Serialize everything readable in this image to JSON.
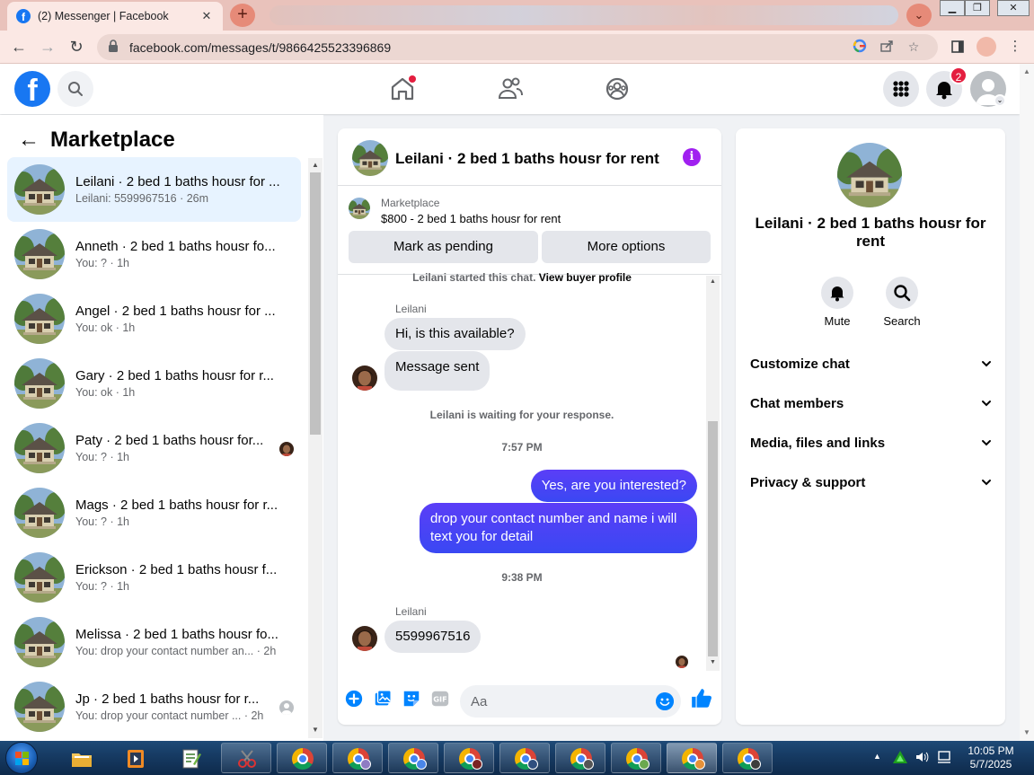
{
  "browser": {
    "tab_title": "(2) Messenger | Facebook",
    "url": "facebook.com/messages/t/9866425523396869",
    "accent": "#e9c2bb"
  },
  "fb": {
    "notification_count": "2",
    "brand_color": "#1877f2"
  },
  "sidebar": {
    "title": "Marketplace",
    "conversations": [
      {
        "name": "Leilani · 2 bed 1 baths housr for ...",
        "sub": "Leilani: 5599967516 · 26m",
        "active": true
      },
      {
        "name": "Anneth · 2 bed 1 baths housr fo...",
        "sub": "You: ? · 1h"
      },
      {
        "name": "Angel · 2 bed 1 baths housr for ...",
        "sub": "You: ok · 1h"
      },
      {
        "name": "Gary · 2 bed 1 baths housr for r...",
        "sub": "You: ok · 1h"
      },
      {
        "name": "Paty · 2 bed 1 baths housr for...",
        "sub": "You: ? · 1h",
        "seen_avatar": "photo"
      },
      {
        "name": "Mags · 2 bed 1 baths housr for r...",
        "sub": "You: ? · 1h"
      },
      {
        "name": "Erickson · 2 bed 1 baths housr f...",
        "sub": "You: ? · 1h"
      },
      {
        "name": "Melissa · 2 bed 1 baths housr fo...",
        "sub": "You: drop your contact number an... · 2h"
      },
      {
        "name": "Jp · 2 bed 1 baths housr for r...",
        "sub": "You: drop your contact number ... · 2h",
        "seen_avatar": "default"
      }
    ]
  },
  "chat": {
    "title": "Leilani · 2 bed 1 baths housr for rent",
    "item_label": "Marketplace",
    "item_price": "$800 - 2 bed 1 baths housr for rent",
    "mark_pending": "Mark as pending",
    "more_options": "More options",
    "started_text": "Leilani started this chat.",
    "view_profile": "View buyer profile",
    "sender_name": "Leilani",
    "msg1": "Hi, is this available?",
    "msg2": "Message sent",
    "waiting": "Leilani is waiting for your response.",
    "time1": "7:57 PM",
    "out1": "Yes, are you interested?",
    "out2": "drop your contact number and name i will text you for detail",
    "time2": "9:38 PM",
    "sender_name2": "Leilani",
    "msg3": "5599967516",
    "composer_placeholder": "Aa",
    "outgoing_color": "#4c3ff0"
  },
  "info": {
    "title": "Leilani · 2 bed 1 baths housr for rent",
    "mute": "Mute",
    "search": "Search",
    "rows": [
      "Customize chat",
      "Chat members",
      "Media, files and links",
      "Privacy & support"
    ]
  },
  "taskbar": {
    "time": "10:05 PM",
    "date": "5/7/2025"
  }
}
